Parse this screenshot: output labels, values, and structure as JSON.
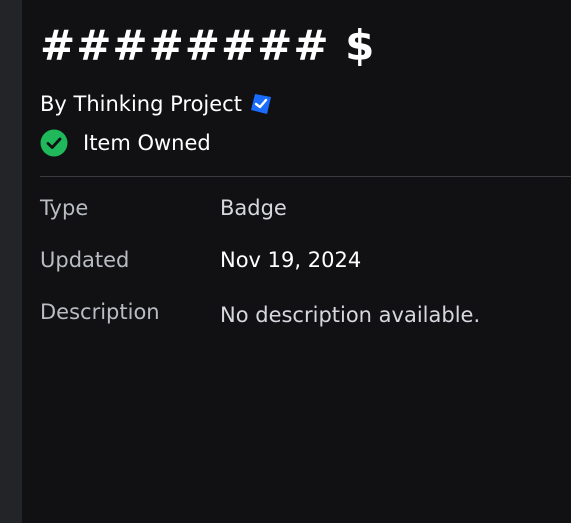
{
  "item": {
    "title": "######## $",
    "creator_text": "By Thinking Project",
    "owned_text": "Item Owned"
  },
  "details": [
    {
      "label": "Type",
      "value": "Badge"
    },
    {
      "label": "Updated",
      "value": "Nov 19, 2024"
    },
    {
      "label": "Description",
      "value": "No description available."
    }
  ],
  "icons": {
    "verified": "verified-badge-icon",
    "owned": "checkmark-circle-icon"
  },
  "colors": {
    "background": "#111114",
    "sidebar": "#232428",
    "label": "#b9bcc3",
    "value_type": "#d6d8dd",
    "value_strong": "#ffffff",
    "verified": "#1a6cff",
    "owned": "#1fb85a"
  }
}
